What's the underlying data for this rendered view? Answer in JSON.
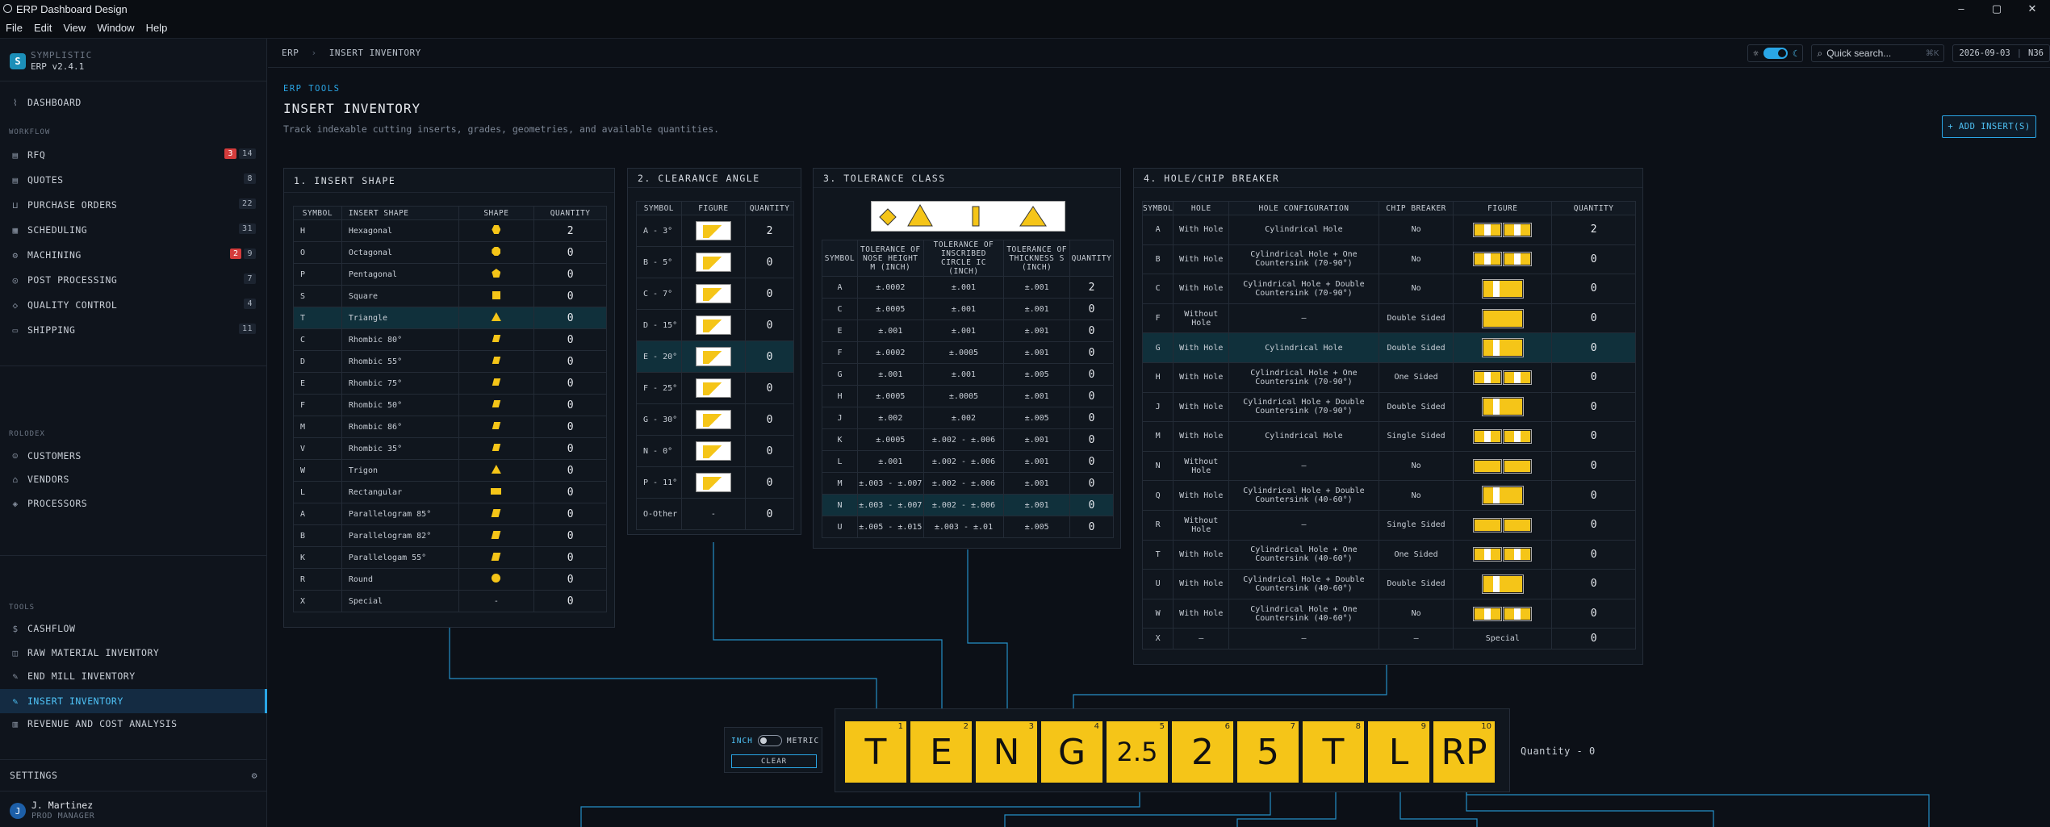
{
  "window": {
    "title": "ERP Dashboard Design",
    "controls": [
      "–",
      "▢",
      "✕"
    ]
  },
  "menu": [
    "File",
    "Edit",
    "View",
    "Window",
    "Help"
  ],
  "brand": {
    "name": "SYMPLISTIC",
    "version": "ERP v2.4.1",
    "badge": "S"
  },
  "sidebar": {
    "dashboard": "DASHBOARD",
    "workflow_label": "WORKFLOW",
    "workflow": [
      {
        "label": "RFQ",
        "alert": "3",
        "count": "14",
        "icon": "document-icon"
      },
      {
        "label": "QUOTES",
        "count": "8",
        "icon": "quote-icon"
      },
      {
        "label": "PURCHASE ORDERS",
        "count": "22",
        "icon": "cart-icon"
      },
      {
        "label": "SCHEDULING",
        "count": "31",
        "icon": "calendar-icon"
      },
      {
        "label": "MACHINING",
        "alert": "2",
        "count": "9",
        "icon": "gear-icon"
      },
      {
        "label": "POST PROCESSING",
        "count": "7",
        "icon": "process-icon"
      },
      {
        "label": "QUALITY CONTROL",
        "count": "4",
        "icon": "shield-icon"
      },
      {
        "label": "SHIPPING",
        "count": "11",
        "icon": "truck-icon"
      }
    ],
    "rolodex_label": "ROLODEX",
    "rolodex": [
      "CUSTOMERS",
      "VENDORS",
      "PROCESSORS"
    ],
    "tools_label": "TOOLS",
    "tools": [
      "CASHFLOW",
      "RAW MATERIAL INVENTORY",
      "END MILL INVENTORY",
      "INSERT INVENTORY",
      "REVENUE AND COST ANALYSIS"
    ],
    "settings": "SETTINGS",
    "user": {
      "name": "J. Martinez",
      "role": "PROD MANAGER",
      "initial": "J"
    }
  },
  "topbar": {
    "crumb1": "ERP",
    "crumb2": "INSERT INVENTORY",
    "search_placeholder": "Quick search...",
    "search_key": "⌘K",
    "date": "2026-09-03",
    "time": "N36"
  },
  "page": {
    "kicker": "ERP TOOLS",
    "title": "INSERT INVENTORY",
    "subtitle": "Track indexable cutting inserts, grades, geometries, and available quantities.",
    "add_button": "+ ADD INSERT(S)"
  },
  "shape_panel": {
    "title": "1. INSERT SHAPE",
    "headers": [
      "SYMBOL",
      "INSERT SHAPE",
      "SHAPE",
      "QUANTITY"
    ],
    "rows": [
      [
        "H",
        "Hexagonal",
        "hex",
        "2"
      ],
      [
        "O",
        "Octagonal",
        "oct",
        "0"
      ],
      [
        "P",
        "Pentagonal",
        "pent",
        "0"
      ],
      [
        "S",
        "Square",
        "sq",
        "0"
      ],
      [
        "T",
        "Triangle",
        "tri",
        "0"
      ],
      [
        "C",
        "Rhombic 80°",
        "rh",
        "0"
      ],
      [
        "D",
        "Rhombic 55°",
        "rh",
        "0"
      ],
      [
        "E",
        "Rhombic 75°",
        "rh",
        "0"
      ],
      [
        "F",
        "Rhombic 50°",
        "rh",
        "0"
      ],
      [
        "M",
        "Rhombic 86°",
        "rh",
        "0"
      ],
      [
        "V",
        "Rhombic 35°",
        "rh",
        "0"
      ],
      [
        "W",
        "Trigon",
        "tri",
        "0"
      ],
      [
        "L",
        "Rectangular",
        "rect",
        "0"
      ],
      [
        "A",
        "Parallelogram 85°",
        "par",
        "0"
      ],
      [
        "B",
        "Parallelogram 82°",
        "par",
        "0"
      ],
      [
        "K",
        "Parallelogam 55°",
        "par",
        "0"
      ],
      [
        "R",
        "Round",
        "round",
        "0"
      ],
      [
        "X",
        "Special",
        "-",
        "0"
      ]
    ]
  },
  "clearance_panel": {
    "title": "2. CLEARANCE ANGLE",
    "headers": [
      "SYMBOL",
      "FIGURE",
      "QUANTITY"
    ],
    "rows": [
      [
        "A - 3°",
        "2"
      ],
      [
        "B - 5°",
        "0"
      ],
      [
        "C - 7°",
        "0"
      ],
      [
        "D - 15°",
        "0"
      ],
      [
        "E - 20°",
        "0"
      ],
      [
        "F - 25°",
        "0"
      ],
      [
        "G - 30°",
        "0"
      ],
      [
        "N - 0°",
        "0"
      ],
      [
        "P - 11°",
        "0"
      ],
      [
        "O-Other",
        "0"
      ]
    ]
  },
  "tolerance_panel": {
    "title": "3. TOLERANCE CLASS",
    "image_caption": "Triangular insert with a fixed Checkmarks Cutting Edges",
    "headers": [
      "SYMBOL",
      "TOLERANCE OF NOSE HEIGHT M (INCH)",
      "TOLERANCE OF INSCRIBED CIRCLE IC (INCH)",
      "TOLERANCE OF THICKNESS S (INCH)",
      "QUANTITY"
    ],
    "rows": [
      [
        "A",
        "±.0002",
        "±.001",
        "±.001",
        "2"
      ],
      [
        "C",
        "±.0005",
        "±.001",
        "±.001",
        "0"
      ],
      [
        "E",
        "±.001",
        "±.001",
        "±.001",
        "0"
      ],
      [
        "F",
        "±.0002",
        "±.0005",
        "±.001",
        "0"
      ],
      [
        "G",
        "±.001",
        "±.001",
        "±.005",
        "0"
      ],
      [
        "H",
        "±.0005",
        "±.0005",
        "±.001",
        "0"
      ],
      [
        "J",
        "±.002",
        "±.002",
        "±.005",
        "0"
      ],
      [
        "K",
        "±.0005",
        "±.002 - ±.006",
        "±.001",
        "0"
      ],
      [
        "L",
        "±.001",
        "±.002 - ±.006",
        "±.001",
        "0"
      ],
      [
        "M",
        "±.003 - ±.007",
        "±.002 - ±.006",
        "±.001",
        "0"
      ],
      [
        "N",
        "±.003 - ±.007",
        "±.002 - ±.006",
        "±.001",
        "0"
      ],
      [
        "U",
        "±.005 - ±.015",
        "±.003 - ±.01",
        "±.005",
        "0"
      ]
    ]
  },
  "hole_panel": {
    "title": "4. HOLE/CHIP BREAKER",
    "headers": [
      "SYMBOL",
      "HOLE",
      "HOLE CONFIGURATION",
      "CHIP BREAKER",
      "FIGURE",
      "QUANTITY"
    ],
    "rows": [
      [
        "A",
        "With Hole",
        "Cylindrical Hole",
        "No",
        "double",
        "2"
      ],
      [
        "B",
        "With Hole",
        "Cylindrical Hole + One Countersink (70-90°)",
        "No",
        "double",
        "0"
      ],
      [
        "C",
        "With Hole",
        "Cylindrical Hole + Double Countersink (70-90°)",
        "No",
        "single",
        "0"
      ],
      [
        "F",
        "Without Hole",
        "–",
        "Double Sided",
        "single-nohole",
        "0"
      ],
      [
        "G",
        "With Hole",
        "Cylindrical Hole",
        "Double Sided",
        "single",
        "0"
      ],
      [
        "H",
        "With Hole",
        "Cylindrical Hole + One Countersink (70-90°)",
        "One Sided",
        "double",
        "0"
      ],
      [
        "J",
        "With Hole",
        "Cylindrical Hole + Double Countersink (70-90°)",
        "Double Sided",
        "single",
        "0"
      ],
      [
        "M",
        "With Hole",
        "Cylindrical Hole",
        "Single Sided",
        "double",
        "0"
      ],
      [
        "N",
        "Without Hole",
        "–",
        "No",
        "double-nohole",
        "0"
      ],
      [
        "Q",
        "With Hole",
        "Cylindrical Hole + Double Countersink (40-60°)",
        "No",
        "single",
        "0"
      ],
      [
        "R",
        "Without Hole",
        "–",
        "Single Sided",
        "double-nohole",
        "0"
      ],
      [
        "T",
        "With Hole",
        "Cylindrical Hole + One Countersink (40-60°)",
        "One Sided",
        "double",
        "0"
      ],
      [
        "U",
        "With Hole",
        "Cylindrical Hole + Double Countersink (40-60°)",
        "Double Sided",
        "single",
        "0"
      ],
      [
        "W",
        "With Hole",
        "Cylindrical Hole + One Countersink (40-60°)",
        "No",
        "double",
        "0"
      ],
      [
        "X",
        "–",
        "–",
        "–",
        "Special",
        "0"
      ]
    ]
  },
  "units": {
    "inch": "INCH",
    "metric": "METRIC",
    "clear": "CLEAR"
  },
  "code": [
    {
      "ch": "T",
      "ix": "1"
    },
    {
      "ch": "E",
      "ix": "2"
    },
    {
      "ch": "N",
      "ix": "3"
    },
    {
      "ch": "G",
      "ix": "4"
    },
    {
      "ch": "2.5",
      "ix": "5"
    },
    {
      "ch": "2",
      "ix": "6"
    },
    {
      "ch": "5",
      "ix": "7"
    },
    {
      "ch": "T",
      "ix": "8"
    },
    {
      "ch": "L",
      "ix": "9"
    },
    {
      "ch": "RP",
      "ix": "10"
    }
  ],
  "quantity_text": "Quantity - 0",
  "colors": {
    "accent": "#2aa6e6",
    "insert_yellow": "#f5c518",
    "alert": "#d43c3c",
    "selected_row": "#10303b"
  }
}
